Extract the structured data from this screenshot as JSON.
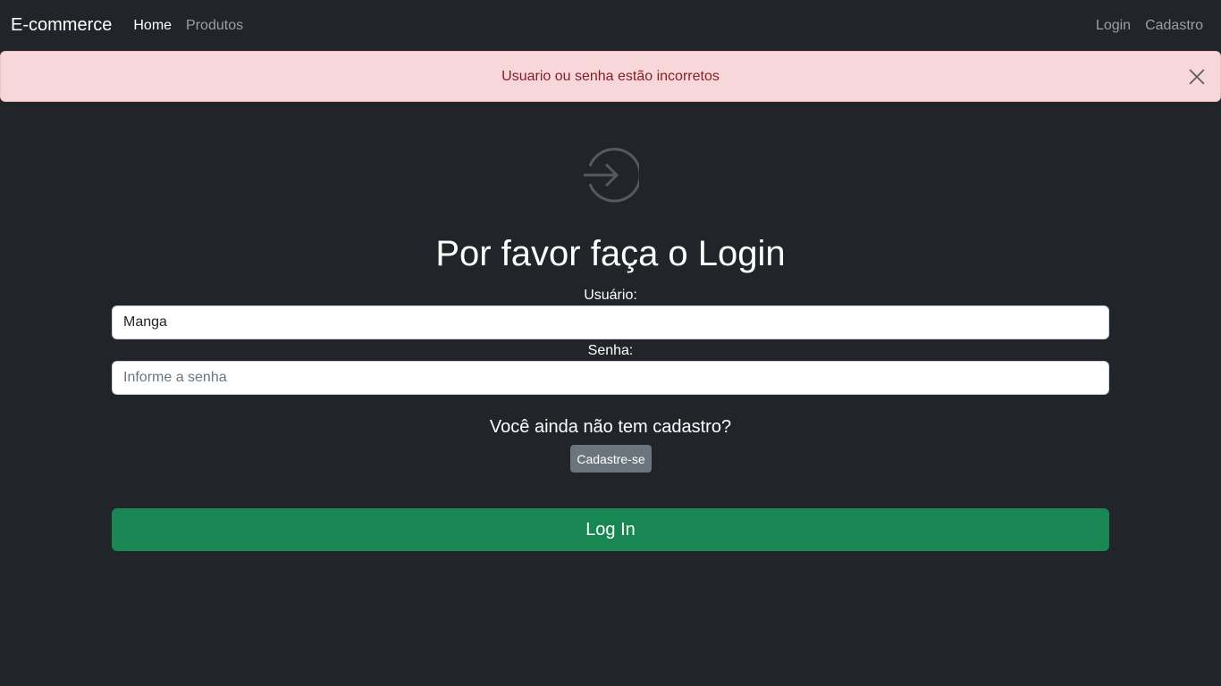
{
  "navbar": {
    "brand": "E-commerce",
    "left_links": [
      {
        "label": "Home",
        "active": true
      },
      {
        "label": "Produtos",
        "active": false
      }
    ],
    "right_links": [
      {
        "label": "Login"
      },
      {
        "label": "Cadastro"
      }
    ]
  },
  "alert": {
    "message": "Usuario ou senha estão incorretos",
    "close_icon": "close-icon"
  },
  "login_icon": "box-arrow-in-right-icon",
  "form": {
    "title": "Por favor faça o Login",
    "user_label": "Usuário:",
    "user_value": "Manga",
    "password_label": "Senha:",
    "password_placeholder": "Informe a senha",
    "signup_prompt": "Você ainda não tem cadastro?",
    "signup_button": "Cadastre-se",
    "submit_button": "Log In"
  },
  "colors": {
    "background": "#212529",
    "alert_bg": "#f8d7da",
    "alert_text": "#842029",
    "success": "#198754",
    "secondary": "#6c757d"
  }
}
